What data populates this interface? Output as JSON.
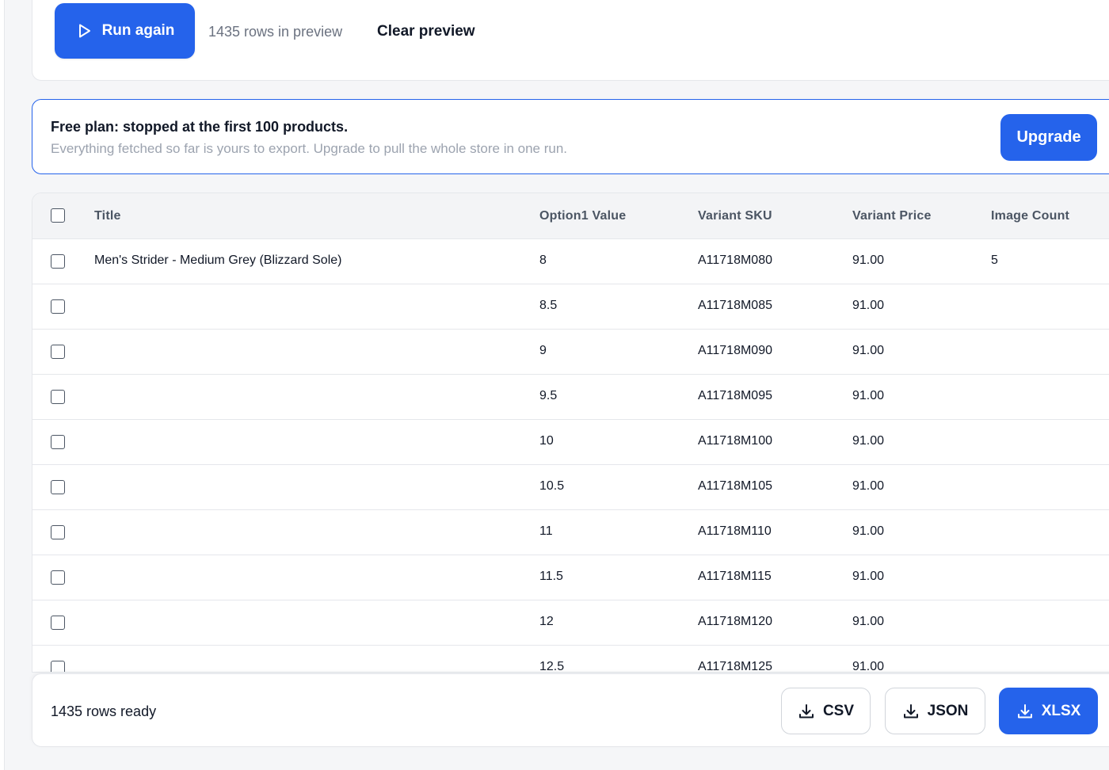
{
  "toolbar": {
    "run_label": "Run again",
    "rows_preview": "1435 rows in preview",
    "clear_label": "Clear preview"
  },
  "notice": {
    "title": "Free plan: stopped at the first 100 products.",
    "subtitle": "Everything fetched so far is yours to export. Upgrade to pull the whole store in one run.",
    "upgrade_label": "Upgrade"
  },
  "table": {
    "columns": [
      "Title",
      "Option1 Value",
      "Variant SKU",
      "Variant Price",
      "Image Count"
    ],
    "rows": [
      {
        "title": "Men's Strider - Medium Grey (Blizzard Sole)",
        "option1": "8",
        "sku": "A11718M080",
        "price": "91.00",
        "images": "5"
      },
      {
        "title": "",
        "option1": "8.5",
        "sku": "A11718M085",
        "price": "91.00",
        "images": ""
      },
      {
        "title": "",
        "option1": "9",
        "sku": "A11718M090",
        "price": "91.00",
        "images": ""
      },
      {
        "title": "",
        "option1": "9.5",
        "sku": "A11718M095",
        "price": "91.00",
        "images": ""
      },
      {
        "title": "",
        "option1": "10",
        "sku": "A11718M100",
        "price": "91.00",
        "images": ""
      },
      {
        "title": "",
        "option1": "10.5",
        "sku": "A11718M105",
        "price": "91.00",
        "images": ""
      },
      {
        "title": "",
        "option1": "11",
        "sku": "A11718M110",
        "price": "91.00",
        "images": ""
      },
      {
        "title": "",
        "option1": "11.5",
        "sku": "A11718M115",
        "price": "91.00",
        "images": ""
      },
      {
        "title": "",
        "option1": "12",
        "sku": "A11718M120",
        "price": "91.00",
        "images": ""
      },
      {
        "title": "",
        "option1": "12.5",
        "sku": "A11718M125",
        "price": "91.00",
        "images": ""
      }
    ]
  },
  "footer": {
    "ready_text": "1435 rows ready",
    "csv_label": "CSV",
    "json_label": "JSON",
    "xlsx_label": "XLSX"
  },
  "icons": {
    "run": "play-icon",
    "download": "download-icon"
  },
  "colors": {
    "accent": "#2563eb",
    "border": "#e5e7eb",
    "muted": "#9ca3af"
  }
}
